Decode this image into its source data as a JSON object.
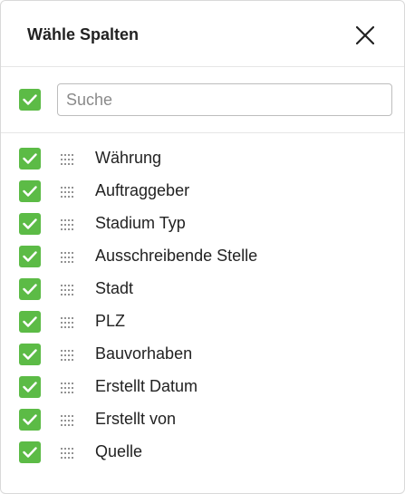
{
  "dialog": {
    "title": "Wähle Spalten",
    "close_icon": "close-icon"
  },
  "search": {
    "select_all_checked": true,
    "placeholder": "Suche",
    "value": ""
  },
  "columns": [
    {
      "label": "Währung",
      "checked": true
    },
    {
      "label": "Auftraggeber",
      "checked": true
    },
    {
      "label": "Stadium Typ",
      "checked": true
    },
    {
      "label": "Ausschreibende Stelle",
      "checked": true
    },
    {
      "label": "Stadt",
      "checked": true
    },
    {
      "label": "PLZ",
      "checked": true
    },
    {
      "label": "Bauvorhaben",
      "checked": true
    },
    {
      "label": "Erstellt Datum",
      "checked": true
    },
    {
      "label": "Erstellt von",
      "checked": true
    },
    {
      "label": "Quelle",
      "checked": true
    }
  ],
  "colors": {
    "checkbox_checked": "#5cbb46",
    "text": "#222222",
    "divider": "#e6e6e6"
  },
  "icons": {
    "checkbox": "checkmark-icon",
    "drag": "drag-handle-icon"
  }
}
